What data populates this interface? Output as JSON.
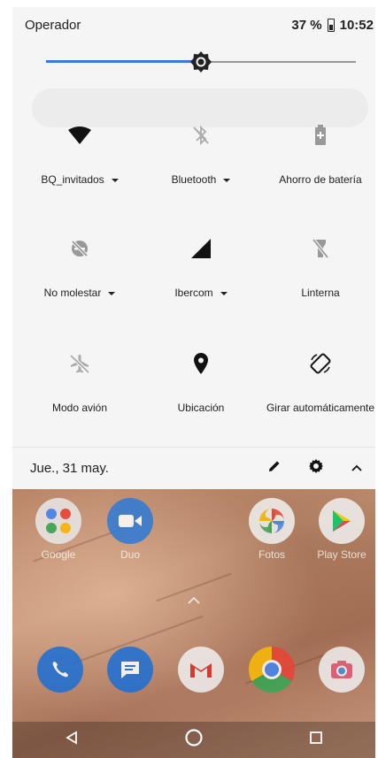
{
  "status_bar": {
    "carrier": "Operador",
    "battery_percent": "37 %",
    "time": "10:52",
    "battery_level": 0.37
  },
  "brightness": {
    "level": 0.5
  },
  "tiles": [
    {
      "label": "BQ_invitados",
      "icon": "wifi-icon",
      "has_dropdown": true
    },
    {
      "label": "Bluetooth",
      "icon": "bluetooth-off-icon",
      "has_dropdown": true
    },
    {
      "label": "Ahorro de batería",
      "icon": "battery-saver-icon",
      "has_dropdown": false
    },
    {
      "label": "No molestar",
      "icon": "do-not-disturb-off-icon",
      "has_dropdown": true
    },
    {
      "label": "Ibercom",
      "icon": "cell-signal-icon",
      "has_dropdown": true
    },
    {
      "label": "Linterna",
      "icon": "flashlight-off-icon",
      "has_dropdown": false
    },
    {
      "label": "Modo avión",
      "icon": "airplane-off-icon",
      "has_dropdown": false
    },
    {
      "label": "Ubicación",
      "icon": "location-icon",
      "has_dropdown": false
    },
    {
      "label": "Girar automáticamente",
      "icon": "auto-rotate-icon",
      "has_dropdown": false
    }
  ],
  "footer": {
    "date": "Jue., 31 may.",
    "edit_icon": "pencil-icon",
    "settings_icon": "gear-icon",
    "collapse_icon": "chevron-up-icon"
  },
  "home": {
    "apps_row1": [
      {
        "label": "Google",
        "icon": "google-folder-icon"
      },
      {
        "label": "Duo",
        "icon": "duo-icon"
      },
      {
        "label": "Fotos",
        "icon": "photos-icon"
      },
      {
        "label": "Play Store",
        "icon": "play-store-icon"
      }
    ],
    "dock": [
      {
        "icon": "phone-icon"
      },
      {
        "icon": "messages-icon"
      },
      {
        "icon": "gmail-icon"
      },
      {
        "icon": "chrome-icon"
      },
      {
        "icon": "camera-icon"
      }
    ]
  },
  "nav": {
    "back": "back-icon",
    "home": "home-icon",
    "recents": "recents-icon"
  }
}
